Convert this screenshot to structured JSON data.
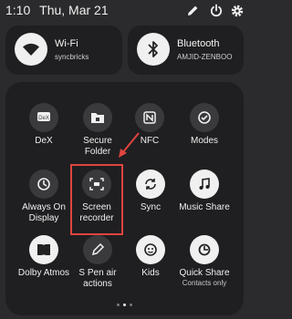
{
  "status_bar": {
    "time": "1:10",
    "date": "Thu, Mar 21",
    "icons": [
      "pencil-icon",
      "power-icon",
      "gear-icon"
    ]
  },
  "wifi_card": {
    "title": "Wi-Fi",
    "subtitle": "syncbricks",
    "icon": "wifi-icon",
    "state": "on"
  },
  "bluetooth_card": {
    "title": "Bluetooth",
    "subtitle": "AMJID-ZENBOO",
    "icon": "bluetooth-icon",
    "state": "on"
  },
  "tiles": [
    {
      "label": "DeX",
      "icon": "dex-icon",
      "state": "off"
    },
    {
      "label": "Secure Folder",
      "icon": "secure-folder-icon",
      "state": "off"
    },
    {
      "label": "NFC",
      "icon": "nfc-icon",
      "state": "off"
    },
    {
      "label": "Modes",
      "icon": "modes-icon",
      "state": "off"
    },
    {
      "label": "Always On Display",
      "icon": "always-on-display-icon",
      "state": "off"
    },
    {
      "label": "Screen recorder",
      "icon": "screen-recorder-icon",
      "state": "off"
    },
    {
      "label": "Sync",
      "icon": "sync-icon",
      "state": "on"
    },
    {
      "label": "Music Share",
      "icon": "music-share-icon",
      "state": "on"
    },
    {
      "label": "Dolby Atmos",
      "icon": "dolby-atmos-icon",
      "state": "on"
    },
    {
      "label": "S Pen air actions",
      "icon": "s-pen-icon",
      "state": "off"
    },
    {
      "label": "Kids",
      "icon": "kids-icon",
      "state": "off"
    },
    {
      "label": "Quick Share",
      "sublabel": "Contacts only",
      "icon": "quick-share-icon",
      "state": "on"
    }
  ],
  "annotation": {
    "color": "#e0443e"
  },
  "pager": {
    "pages": 3,
    "active": 2
  },
  "colors": {
    "panel": "#1f1f21",
    "background": "#2b2b2d",
    "tile_on": "#f0f0f0",
    "tile_off": "#3a3a3c"
  }
}
